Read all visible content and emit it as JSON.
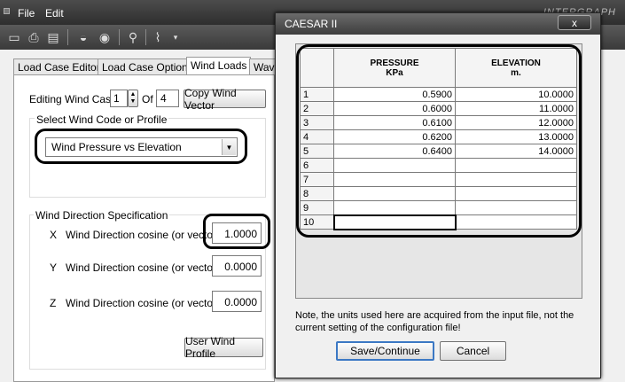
{
  "menu": {
    "file": "File",
    "edit": "Edit"
  },
  "brand": "INTERGRAPH",
  "tabs": [
    {
      "label": "Load Case Editor"
    },
    {
      "label": "Load Case Options"
    },
    {
      "label": "Wind Loads"
    },
    {
      "label": "Wav"
    }
  ],
  "editing": {
    "label": "Editing Wind Case",
    "value": "1",
    "of_label": "Of",
    "total": "4",
    "copy_button": "Copy Wind Vector"
  },
  "wind_code": {
    "group_label": "Select Wind Code or Profile",
    "selected": "Wind Pressure vs Elevation"
  },
  "direction": {
    "group_label": "Wind Direction Specification",
    "x": {
      "axis": "X",
      "label": "Wind Direction cosine (or vector)",
      "value": "1.0000"
    },
    "y": {
      "axis": "Y",
      "label": "Wind Direction cosine (or vector)",
      "value": "0.0000"
    },
    "z": {
      "axis": "Z",
      "label": "Wind Direction cosine (or vector)",
      "value": "0.0000"
    }
  },
  "user_profile_button": "User Wind Profile",
  "dialog": {
    "title": "CAESAR II",
    "close": "x",
    "headers": {
      "pressure_line1": "PRESSURE",
      "pressure_line2": "KPa",
      "elevation_line1": "ELEVATION",
      "elevation_line2": "m."
    },
    "rows": [
      {
        "n": "1",
        "pressure": "0.5900",
        "elevation": "10.0000"
      },
      {
        "n": "2",
        "pressure": "0.6000",
        "elevation": "11.0000"
      },
      {
        "n": "3",
        "pressure": "0.6100",
        "elevation": "12.0000"
      },
      {
        "n": "4",
        "pressure": "0.6200",
        "elevation": "13.0000"
      },
      {
        "n": "5",
        "pressure": "0.6400",
        "elevation": "14.0000"
      },
      {
        "n": "6",
        "pressure": "",
        "elevation": ""
      },
      {
        "n": "7",
        "pressure": "",
        "elevation": ""
      },
      {
        "n": "8",
        "pressure": "",
        "elevation": ""
      },
      {
        "n": "9",
        "pressure": "",
        "elevation": ""
      },
      {
        "n": "10",
        "pressure": "",
        "elevation": ""
      }
    ],
    "note": "Note, the units used here are acquired from the input file, not the current setting of the configuration file!",
    "save_button": "Save/Continue",
    "cancel_button": "Cancel"
  }
}
